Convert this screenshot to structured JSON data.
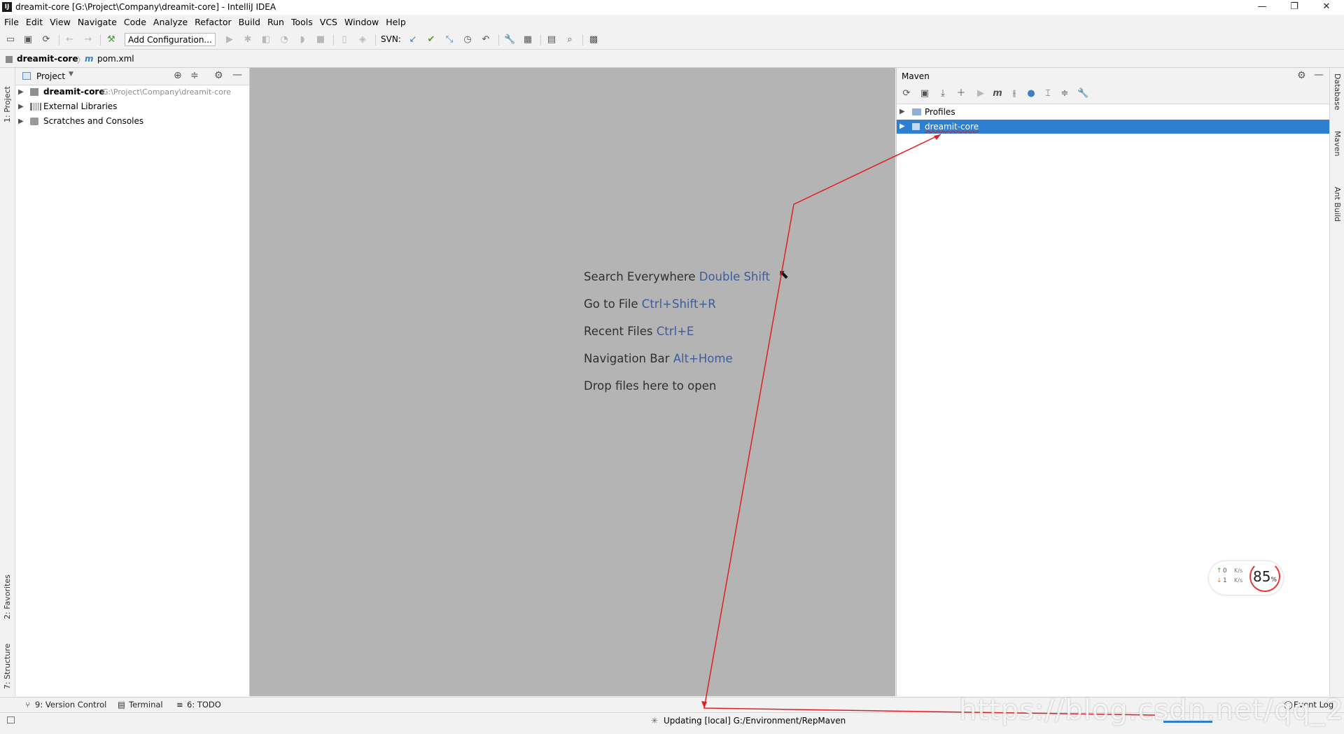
{
  "window": {
    "title": "dreamit-core [G:\\Project\\Company\\dreamit-core] - IntelliJ IDEA",
    "minimize": "—",
    "restore": "❐",
    "close": "✕"
  },
  "menu": [
    "File",
    "Edit",
    "View",
    "Navigate",
    "Code",
    "Analyze",
    "Refactor",
    "Build",
    "Run",
    "Tools",
    "VCS",
    "Window",
    "Help"
  ],
  "toolbar": {
    "add_configuration": "Add Configuration...",
    "svn_label": "SVN:"
  },
  "breadcrumb": {
    "project": "dreamit-core",
    "file": "pom.xml"
  },
  "left_stripe": {
    "project_tab": "1: Project",
    "favorites_tab": "2: Favorites",
    "structure_tab": "7: Structure"
  },
  "project_panel": {
    "header": "Project",
    "tree": [
      {
        "label": "dreamit-core",
        "path": "G:\\Project\\Company\\dreamit-core"
      },
      {
        "label": "External Libraries"
      },
      {
        "label": "Scratches and Consoles"
      }
    ]
  },
  "editor": {
    "hints": [
      {
        "text": "Search Everywhere",
        "shortcut": "Double Shift"
      },
      {
        "text": "Go to File",
        "shortcut": "Ctrl+Shift+R"
      },
      {
        "text": "Recent Files",
        "shortcut": "Ctrl+E"
      },
      {
        "text": "Navigation Bar",
        "shortcut": "Alt+Home"
      },
      {
        "text": "Drop files here to open",
        "shortcut": ""
      }
    ]
  },
  "maven_panel": {
    "header": "Maven",
    "tree": [
      {
        "label": "Profiles",
        "selected": false
      },
      {
        "label": "dreamit-core",
        "selected": true
      }
    ]
  },
  "right_stripe": {
    "database_tab": "Database",
    "maven_tab": "Maven",
    "ant_tab": "Ant Build"
  },
  "bottom_tabs": {
    "version_control": "9: Version Control",
    "terminal": "Terminal",
    "todo": "6: TODO",
    "event_log": "Event Log"
  },
  "status": {
    "message": "Updating [local] G:/Environment/RepMaven"
  },
  "widget": {
    "up_speed": "0",
    "down_speed": "1",
    "unit": "K/s",
    "cpu": "85",
    "cpu_unit": "%"
  },
  "watermark": "https://blog.csdn.net/qq_2…",
  "colors": {
    "selection": "#2f7fd1",
    "editor_bg": "#b4b4b4",
    "shortcut": "#3d5c9c",
    "annotation": "#e02020"
  }
}
